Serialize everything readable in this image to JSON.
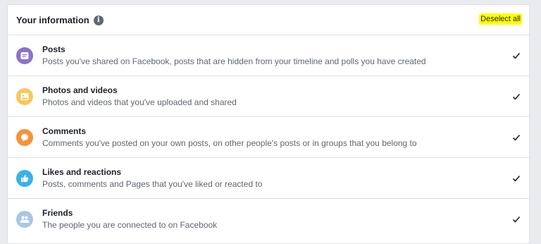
{
  "header": {
    "title": "Your information",
    "info_icon": "info-icon",
    "deselect_label": "Deselect all",
    "deselect_highlight": "#ffff00"
  },
  "items": [
    {
      "title": "Posts",
      "description": "Posts you've shared on Facebook, posts that are hidden from your timeline and polls you have created",
      "icon": "posts-icon",
      "color": "#8c72cb",
      "checked": true
    },
    {
      "title": "Photos and videos",
      "description": "Photos and videos that you've uploaded and shared",
      "icon": "photos-icon",
      "color": "#f7c75e",
      "checked": true
    },
    {
      "title": "Comments",
      "description": "Comments you've posted on your own posts, on other people's posts or in groups that you belong to",
      "icon": "comments-icon",
      "color": "#f7923b",
      "checked": true
    },
    {
      "title": "Likes and reactions",
      "description": "Posts, comments and Pages that you've liked or reacted to",
      "icon": "likes-icon",
      "color": "#39b3e5",
      "checked": true
    },
    {
      "title": "Friends",
      "description": "The people you are connected to on Facebook",
      "icon": "friends-icon",
      "color": "#a8c7e8",
      "checked": true
    }
  ]
}
